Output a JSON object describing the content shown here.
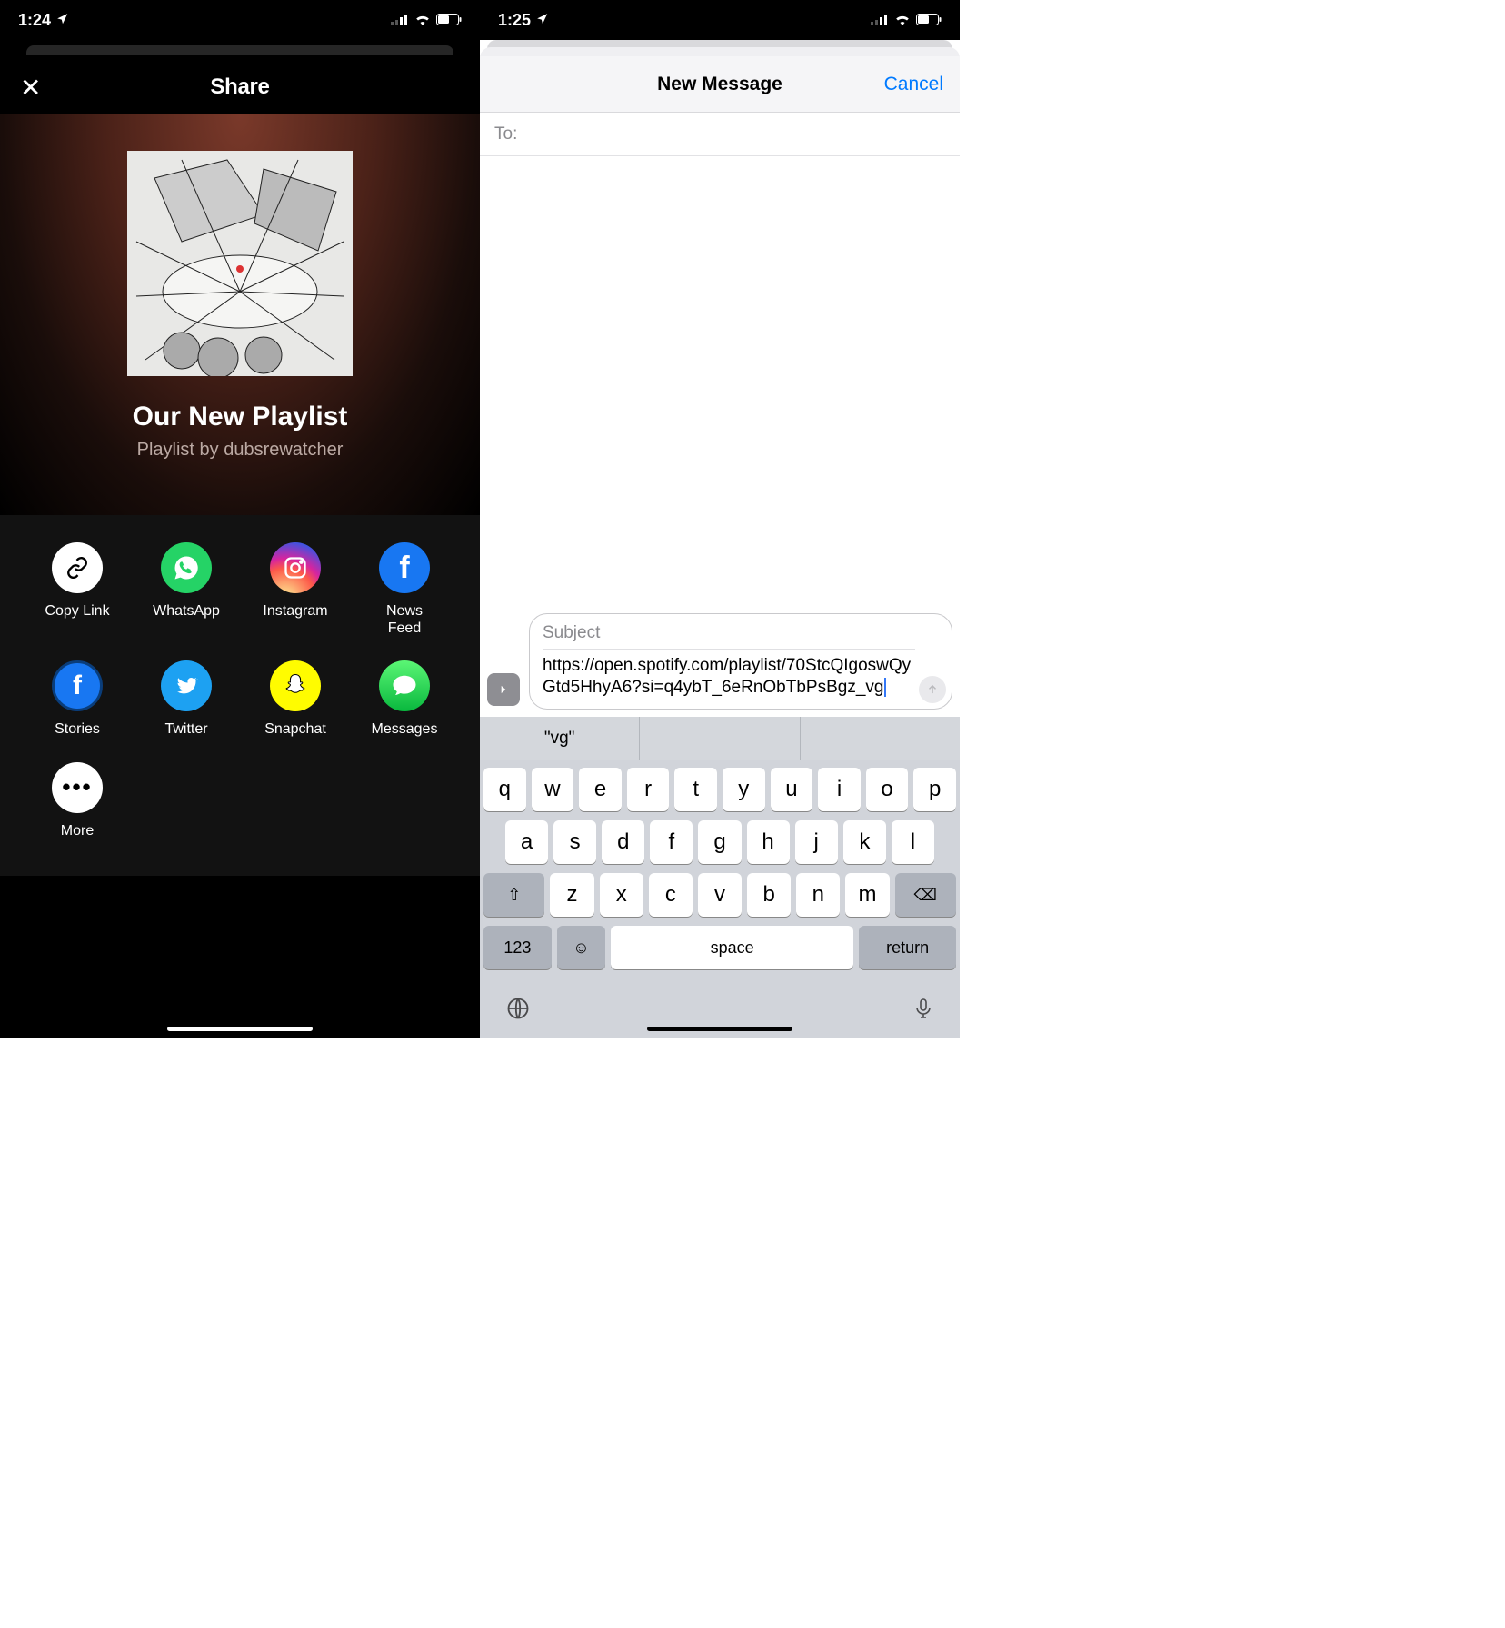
{
  "left": {
    "status": {
      "time": "1:24"
    },
    "header": {
      "title": "Share"
    },
    "playlist": {
      "title": "Our New Playlist",
      "subtitle": "Playlist by dubsrewatcher"
    },
    "share_options": {
      "copy_link": "Copy Link",
      "whatsapp": "WhatsApp",
      "instagram": "Instagram",
      "news_feed": "News\nFeed",
      "stories": "Stories",
      "twitter": "Twitter",
      "snapchat": "Snapchat",
      "messages": "Messages",
      "more": "More"
    }
  },
  "right": {
    "status": {
      "time": "1:25"
    },
    "nav": {
      "title": "New Message",
      "cancel": "Cancel"
    },
    "to_label": "To:",
    "subject_placeholder": "Subject",
    "body": "https://open.spotify.com/playlist/70StcQIgoswQyGtd5HhyA6?si=q4ybT_6eRnObTbPsBgz_vg",
    "suggestion": "\"vg\"",
    "keys": {
      "row1": [
        "q",
        "w",
        "e",
        "r",
        "t",
        "y",
        "u",
        "i",
        "o",
        "p"
      ],
      "row2": [
        "a",
        "s",
        "d",
        "f",
        "g",
        "h",
        "j",
        "k",
        "l"
      ],
      "row3": [
        "z",
        "x",
        "c",
        "v",
        "b",
        "n",
        "m"
      ]
    },
    "fn": {
      "shift": "⇧",
      "backspace": "⌫",
      "num": "123",
      "emoji": "☺",
      "space": "space",
      "ret": "return",
      "globe": "🌐",
      "mic": "🎤"
    }
  }
}
